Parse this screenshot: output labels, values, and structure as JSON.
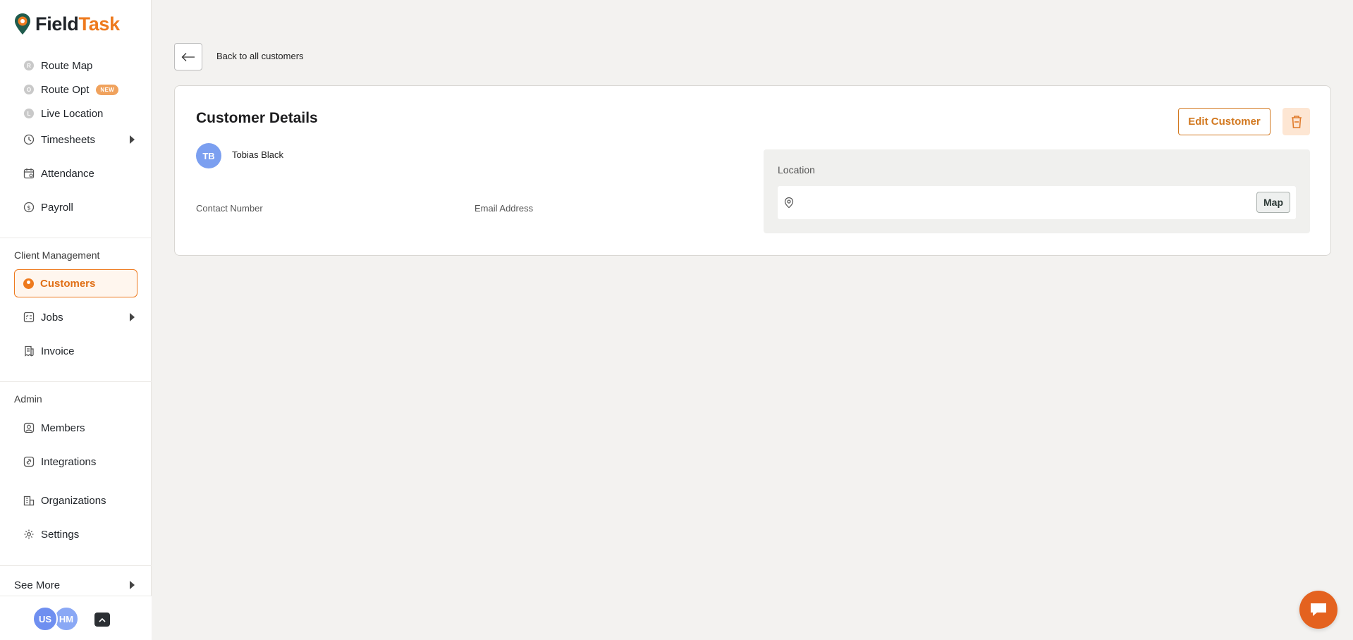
{
  "brand": {
    "name_part1": "Field",
    "name_part2": "Task",
    "accent": "#ee7a1e"
  },
  "sidebar": {
    "top_items": [
      {
        "label": "Route Map",
        "icon": "route-map-dot-icon",
        "icon_letter": "R"
      },
      {
        "label": "Route Opt",
        "icon": "route-opt-dot-icon",
        "icon_letter": "O",
        "badge": "NEW"
      },
      {
        "label": "Live Location",
        "icon": "live-location-dot-icon",
        "icon_letter": "L"
      },
      {
        "label": "Timesheets",
        "icon": "clock-icon",
        "expandable": true
      },
      {
        "label": "Attendance",
        "icon": "calendar-icon"
      },
      {
        "label": "Payroll",
        "icon": "dollar-icon"
      }
    ],
    "client_section": {
      "title": "Client Management",
      "items": [
        {
          "label": "Customers",
          "icon": "customer-icon",
          "active": true
        },
        {
          "label": "Jobs",
          "icon": "jobs-icon",
          "expandable": true
        },
        {
          "label": "Invoice",
          "icon": "invoice-icon"
        }
      ]
    },
    "admin_section": {
      "title": "Admin",
      "items": [
        {
          "label": "Members",
          "icon": "member-icon"
        },
        {
          "label": "Integrations",
          "icon": "integrations-icon"
        },
        {
          "label": "Organizations",
          "icon": "organization-icon"
        },
        {
          "label": "Settings",
          "icon": "gear-icon"
        }
      ]
    },
    "see_more": "See More",
    "footer_avatars": [
      {
        "initials": "US",
        "color": "#6f8ff0"
      },
      {
        "initials": "HM",
        "color": "#8aa8f5"
      }
    ]
  },
  "main": {
    "back_label": "Back to all customers",
    "card": {
      "title": "Customer Details",
      "edit_button": "Edit Customer",
      "customer": {
        "initials": "TB",
        "name": "Tobias Black",
        "avatar_color": "#7b9ff0"
      },
      "contact_label": "Contact Number",
      "email_label": "Email Address",
      "location": {
        "label": "Location",
        "map_button": "Map",
        "value": ""
      }
    }
  }
}
